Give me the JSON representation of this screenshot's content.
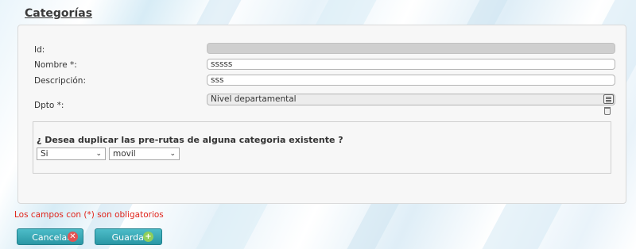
{
  "page": {
    "title": "Categorías"
  },
  "form": {
    "id_label": "Id:",
    "id_value": "",
    "nombre_label": "Nombre *:",
    "nombre_value": "sssss",
    "descripcion_label": "Descripción:",
    "descripcion_value": "sss",
    "dpto_label": "Dpto *:",
    "dpto_value": "Nivel departamental",
    "dpto_icons": [
      "list-icon",
      "trash-icon"
    ]
  },
  "duplicate": {
    "question": "¿ Desea duplicar las pre-rutas de alguna categoria existente ?",
    "answer_selected": "Si",
    "category_selected": "movil"
  },
  "footer": {
    "required_note": "Los campos con (*) son obligatorios",
    "cancel_label": "Cancelar",
    "save_label": "Guardar"
  },
  "colors": {
    "button": "#2a97a5",
    "required_note": "#e0241b",
    "cancel_icon": "#e25353",
    "save_icon": "#8fce5b"
  }
}
